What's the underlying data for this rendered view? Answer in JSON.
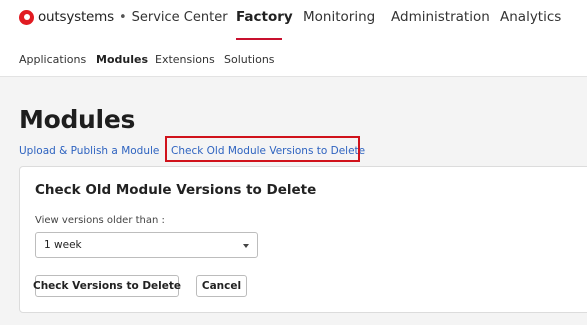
{
  "brand": {
    "name": "outsystems",
    "separator": "•",
    "product": "Service Center",
    "accent_color": "#e11b22"
  },
  "top_nav": {
    "items": [
      {
        "label": "Factory",
        "active": true
      },
      {
        "label": "Monitoring",
        "active": false
      },
      {
        "label": "Administration",
        "active": false
      },
      {
        "label": "Analytics",
        "active": false
      }
    ]
  },
  "sub_nav": {
    "items": [
      {
        "label": "Applications",
        "active": false
      },
      {
        "label": "Modules",
        "active": true
      },
      {
        "label": "Extensions",
        "active": false
      },
      {
        "label": "Solutions",
        "active": false
      }
    ]
  },
  "page": {
    "title": "Modules",
    "actions": [
      {
        "label": "Upload & Publish a Module"
      },
      {
        "label": "Check Old Module Versions to Delete",
        "highlighted": true
      }
    ]
  },
  "panel": {
    "title": "Check Old Module Versions to Delete",
    "field_label": "View versions older than :",
    "select_value": "1 week",
    "primary_button": "Check Versions to Delete",
    "cancel_button": "Cancel"
  },
  "colors": {
    "link": "#2e63c0",
    "highlight": "#d0121b",
    "active_underline": "#c8102e"
  }
}
